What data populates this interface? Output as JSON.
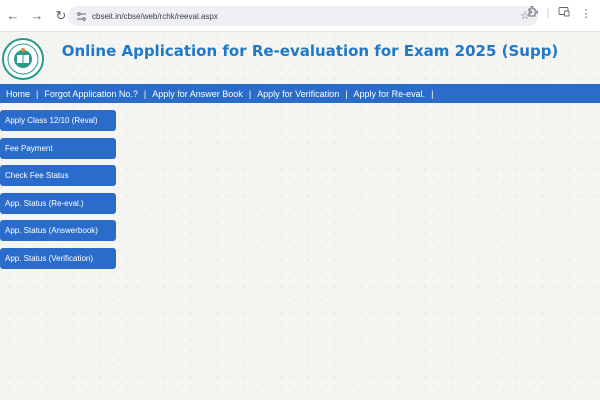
{
  "browser": {
    "url": "cbseit.in/cbse/web/rchk/reeval.aspx"
  },
  "header": {
    "title": "Online Application for Re-evaluation for Exam 2025 (Supp)"
  },
  "menu": {
    "items": [
      "Home",
      "Forgot Application No.?",
      "Apply for Answer Book",
      "Apply for Verification",
      "Apply for Re-eval."
    ],
    "separator": "|"
  },
  "side_menu": {
    "items": [
      "Apply Class 12/10 (Reval)",
      "Fee Payment",
      "Check Fee Status",
      "App. Status (Re-eval.)",
      "App. Status (Answerbook)",
      "App. Status (Verification)"
    ]
  },
  "colors": {
    "title": "#1f78c8",
    "menu_bg": "#2b6ccb",
    "page_bg": "#f5f5f2"
  }
}
